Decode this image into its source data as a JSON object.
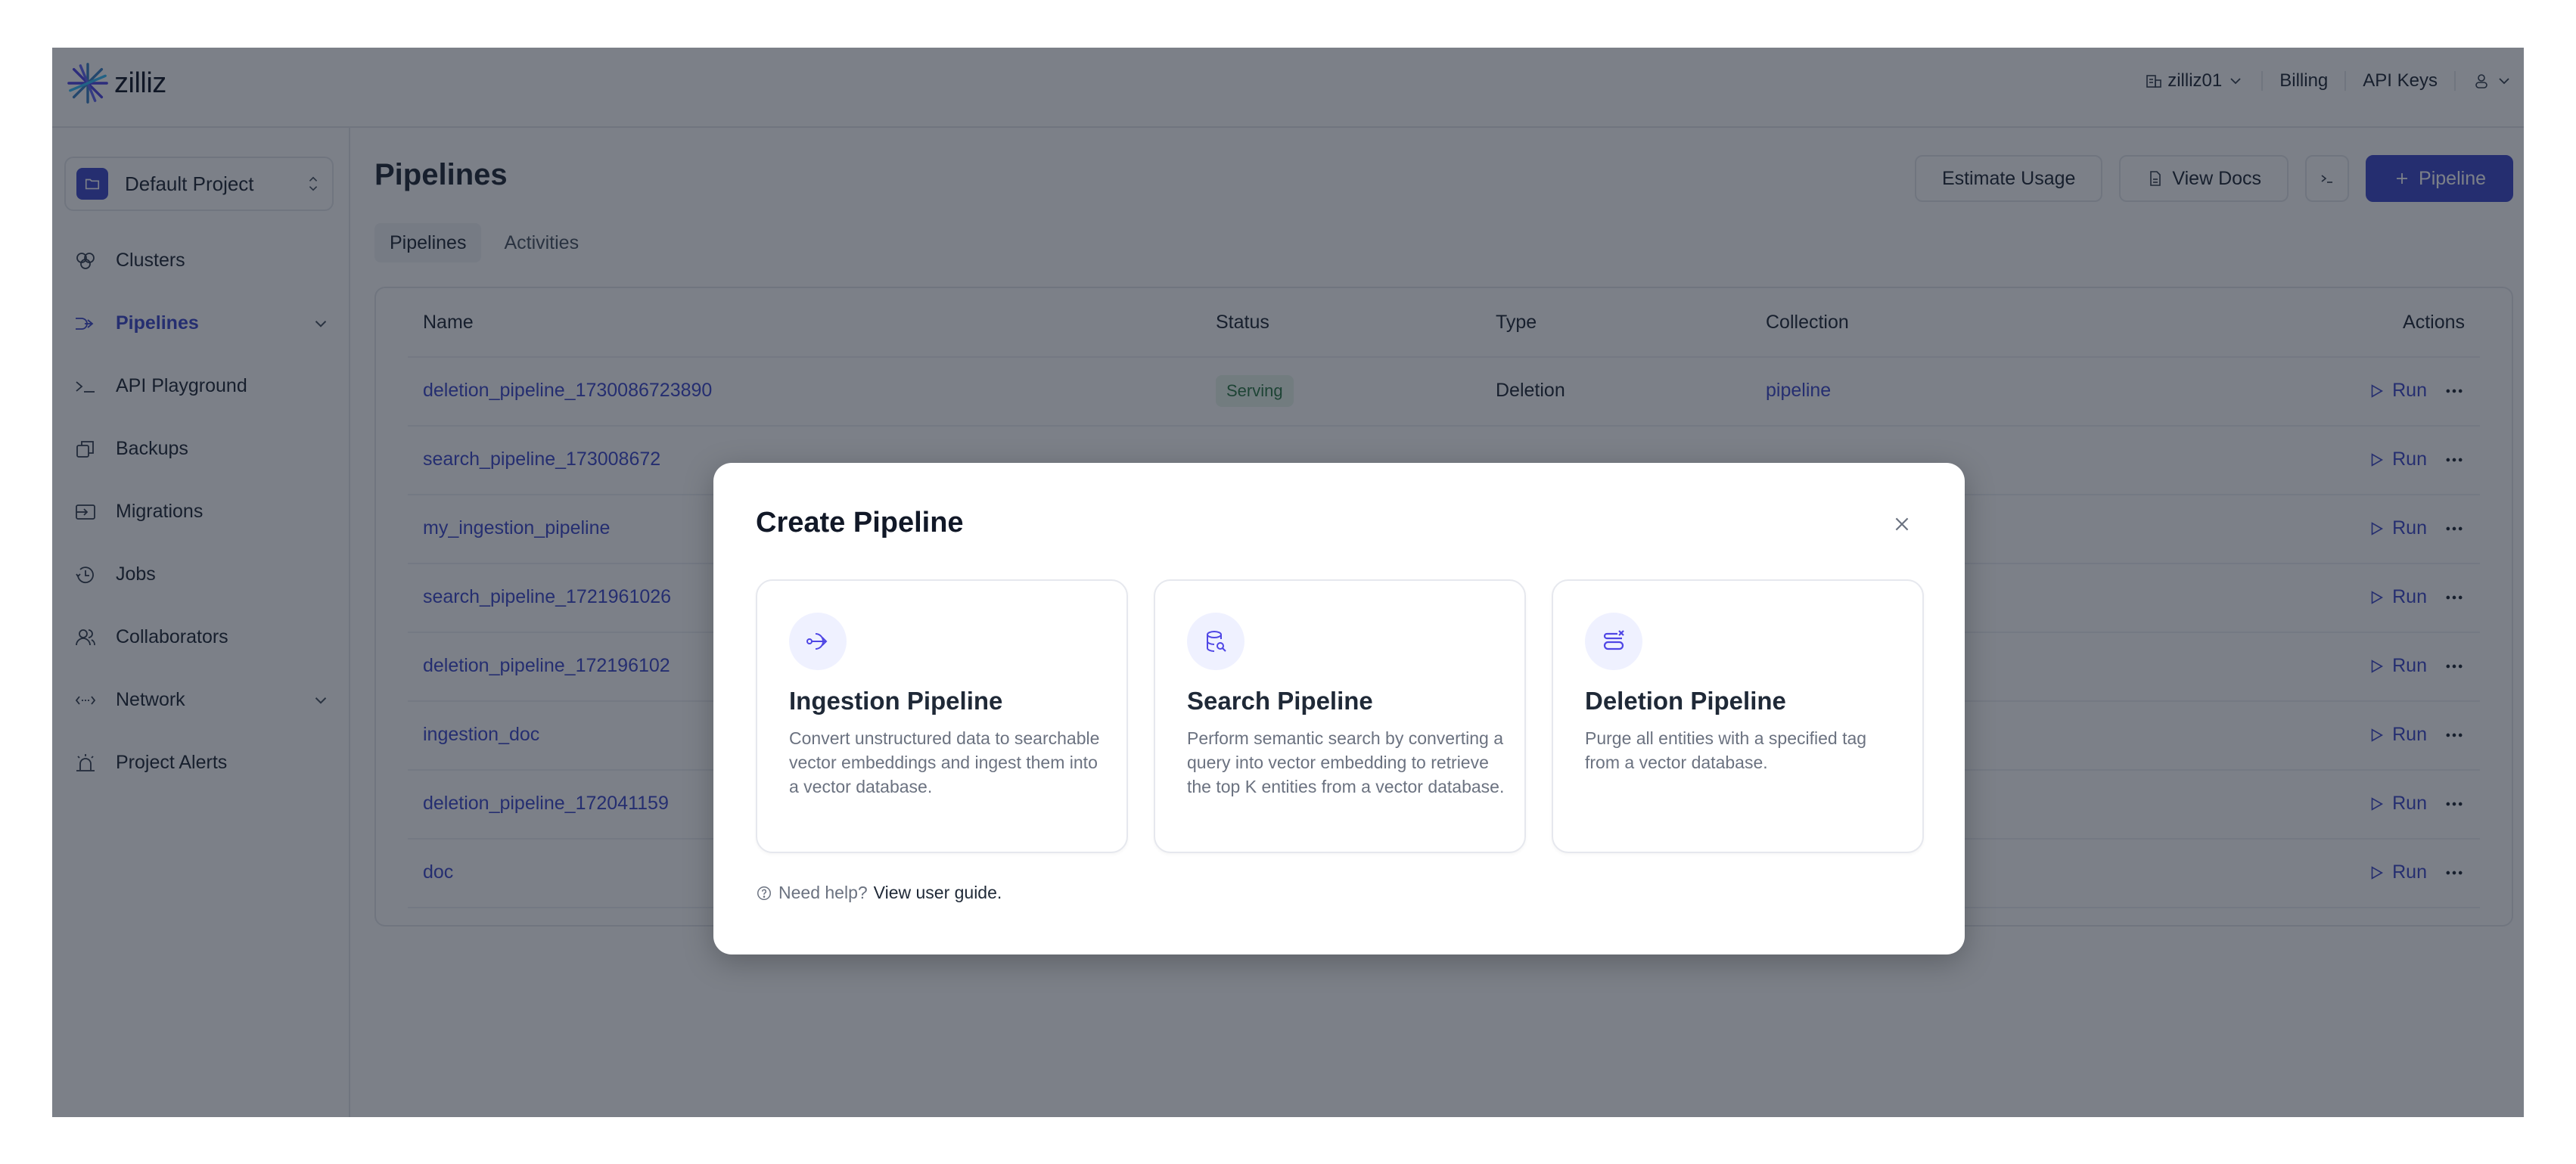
{
  "header": {
    "logo_text": "zilliz",
    "org": "zilliz01",
    "billing": "Billing",
    "api_keys": "API Keys"
  },
  "sidebar": {
    "project": "Default Project",
    "items": [
      {
        "label": "Clusters",
        "icon": "clusters-icon"
      },
      {
        "label": "Pipelines",
        "icon": "pipelines-icon",
        "active": true,
        "expandable": true
      },
      {
        "label": "API Playground",
        "icon": "terminal-icon"
      },
      {
        "label": "Backups",
        "icon": "backups-icon"
      },
      {
        "label": "Migrations",
        "icon": "migrations-icon"
      },
      {
        "label": "Jobs",
        "icon": "jobs-icon"
      },
      {
        "label": "Collaborators",
        "icon": "collaborators-icon"
      },
      {
        "label": "Network",
        "icon": "network-icon",
        "expandable": true
      },
      {
        "label": "Project Alerts",
        "icon": "alerts-icon"
      }
    ]
  },
  "main": {
    "title": "Pipelines",
    "buttons": {
      "estimate": "Estimate Usage",
      "docs": "View Docs",
      "create": "Pipeline"
    },
    "tabs": [
      {
        "label": "Pipelines",
        "active": true
      },
      {
        "label": "Activities",
        "active": false
      }
    ],
    "table": {
      "headers": {
        "name": "Name",
        "status": "Status",
        "type": "Type",
        "collection": "Collection",
        "actions": "Actions"
      },
      "rows": [
        {
          "name": "deletion_pipeline_1730086723890",
          "status": "Serving",
          "type": "Deletion",
          "collection": "pipeline"
        },
        {
          "name": "search_pipeline_173008672",
          "status": "",
          "type": "",
          "collection": ""
        },
        {
          "name": "my_ingestion_pipeline",
          "status": "",
          "type": "",
          "collection": ""
        },
        {
          "name": "search_pipeline_1721961026",
          "status": "",
          "type": "",
          "collection": ""
        },
        {
          "name": "deletion_pipeline_172196102",
          "status": "",
          "type": "",
          "collection": ""
        },
        {
          "name": "ingestion_doc",
          "status": "",
          "type": "",
          "collection": ""
        },
        {
          "name": "deletion_pipeline_172041159",
          "status": "",
          "type": "",
          "collection": ""
        },
        {
          "name": "doc",
          "status": "",
          "type": "",
          "collection": ""
        }
      ],
      "run_label": "Run"
    }
  },
  "modal": {
    "title": "Create Pipeline",
    "cards": [
      {
        "title": "Ingestion Pipeline",
        "description": "Convert unstructured data to searchable vector embeddings and ingest them into a vector database.",
        "icon": "ingestion-icon"
      },
      {
        "title": "Search Pipeline",
        "description": "Perform semantic search by converting a query into vector embedding to retrieve the top K entities from a vector database.",
        "icon": "search-db-icon"
      },
      {
        "title": "Deletion Pipeline",
        "description": "Purge all entities with a specified tag from a vector database.",
        "icon": "deletion-icon"
      }
    ],
    "help_text": "Need help?",
    "help_link": "View user guide."
  },
  "colors": {
    "accent": "#3f4acb",
    "serving_bg": "#e8f5ec",
    "serving_text": "#2f7a48",
    "overlay": "rgba(17,24,39,0.55)"
  }
}
